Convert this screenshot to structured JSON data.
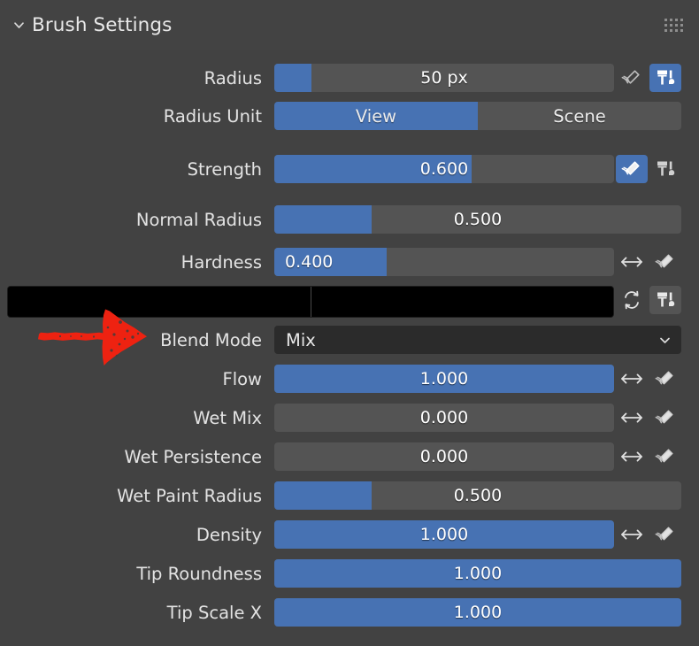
{
  "panel": {
    "title": "Brush Settings",
    "collapse_icon": "chevron-down-icon",
    "grip_icon": "grip-dots-icon"
  },
  "rows": [
    {
      "label": "Radius",
      "type": "slider",
      "value": "50 px",
      "fill_percent": 11,
      "align": "center",
      "icons": [
        "pen-pressure-icon",
        "brush-unified-icon"
      ],
      "icon_states": [
        "off",
        "on"
      ]
    },
    {
      "label": "Radius Unit",
      "type": "toggle",
      "options": [
        "View",
        "Scene"
      ],
      "selected": "View"
    },
    {
      "label": "Strength",
      "type": "slider",
      "value": "0.600",
      "fill_percent": 58,
      "align": "center",
      "icons": [
        "pen-pressure-icon",
        "brush-unified-icon"
      ],
      "icon_states": [
        "on",
        "off"
      ]
    },
    {
      "label": "Normal Radius",
      "type": "slider",
      "value": "0.500",
      "fill_percent": 24,
      "align": "center",
      "icons": [],
      "icon_states": []
    },
    {
      "label": "Hardness",
      "type": "slider",
      "value": "0.400",
      "fill_percent": 33,
      "align": "left",
      "icons": [
        "arrows-horizontal-icon",
        "pen-pressure-icon"
      ],
      "icon_states": [
        "off",
        "off"
      ]
    },
    {
      "label": "",
      "type": "colors",
      "primary_color": "#000000",
      "secondary_color": "#000000",
      "icons": [
        "swap-colors-icon",
        "brush-unified-icon"
      ],
      "icon_states": [
        "off",
        "off"
      ]
    },
    {
      "label": "Blend Mode",
      "type": "dropdown",
      "value": "Mix",
      "caret_icon": "chevron-down-icon"
    },
    {
      "label": "Flow",
      "type": "slider",
      "value": "1.000",
      "fill_percent": 100,
      "align": "center",
      "icons": [
        "arrows-horizontal-icon",
        "pen-pressure-icon"
      ],
      "icon_states": [
        "off",
        "off"
      ]
    },
    {
      "label": "Wet Mix",
      "type": "slider",
      "value": "0.000",
      "fill_percent": 0,
      "align": "center",
      "icons": [
        "arrows-horizontal-icon",
        "pen-pressure-icon"
      ],
      "icon_states": [
        "off",
        "off"
      ]
    },
    {
      "label": "Wet Persistence",
      "type": "slider",
      "value": "0.000",
      "fill_percent": 0,
      "align": "center",
      "icons": [
        "arrows-horizontal-icon",
        "pen-pressure-icon"
      ],
      "icon_states": [
        "off",
        "off"
      ]
    },
    {
      "label": "Wet Paint Radius",
      "type": "slider",
      "value": "0.500",
      "fill_percent": 24,
      "align": "center",
      "icons": [],
      "icon_states": []
    },
    {
      "label": "Density",
      "type": "slider",
      "value": "1.000",
      "fill_percent": 100,
      "align": "center",
      "icons": [
        "arrows-horizontal-icon",
        "pen-pressure-icon"
      ],
      "icon_states": [
        "off",
        "off"
      ]
    },
    {
      "label": "Tip Roundness",
      "type": "slider",
      "value": "1.000",
      "fill_percent": 100,
      "align": "center",
      "icons": [],
      "icon_states": []
    },
    {
      "label": "Tip Scale X",
      "type": "slider",
      "value": "1.000",
      "fill_percent": 100,
      "align": "center",
      "icons": [],
      "icon_states": []
    }
  ],
  "annotation": {
    "type": "arrow",
    "color": "#ee2211",
    "points_to": "Blend Mode"
  },
  "colors": {
    "panel_background": "#424242",
    "slider_track": "#545454",
    "slider_fill": "#4772b3",
    "dropdown_background": "#2b2b2b",
    "text": "#e6e6e6",
    "annotation": "#ee2211"
  }
}
